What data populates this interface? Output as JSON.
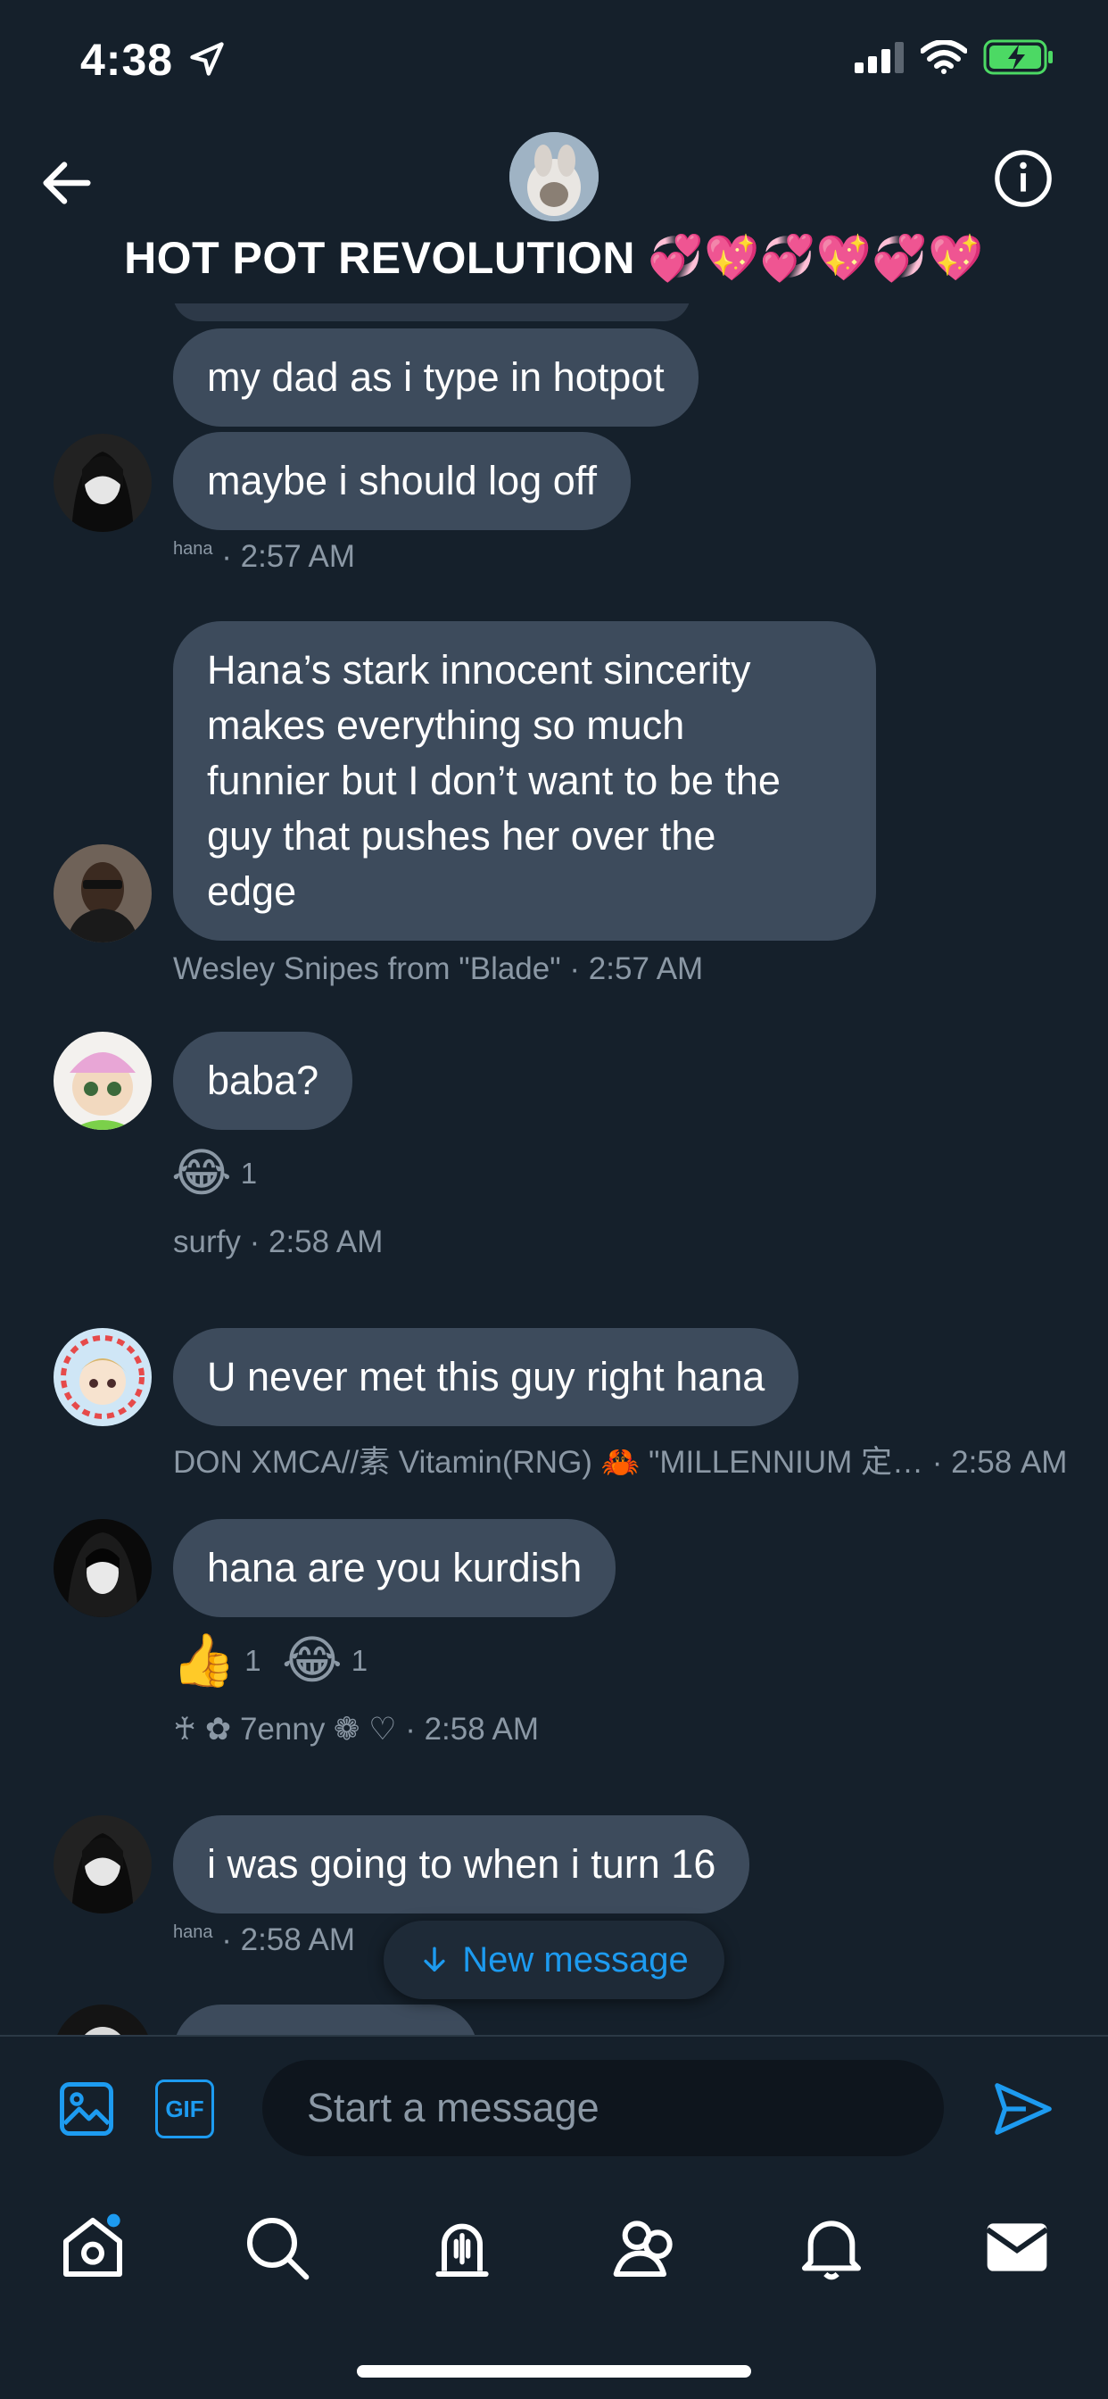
{
  "status_bar": {
    "time": "4:38"
  },
  "header": {
    "title": "HOT POT REVOLUTION 💞💖💞💖💞💖"
  },
  "messages": [
    {
      "text": "my dad as i type in hotpot"
    },
    {
      "text": "maybe i should log off",
      "sender_small": "hana",
      "time": "· 2:57 AM"
    },
    {
      "text": "Hana’s stark innocent sincerity\nmakes everything so much\nfunnier but I don’t want to be the\nguy that pushes her over the\nedge",
      "sender": "Wesley Snipes from \"Blade\"",
      "time": "· 2:57 AM"
    },
    {
      "text": "baba?",
      "reaction_emoji": "😂",
      "reaction_count": "1",
      "sender": "surfy",
      "time": "· 2:58 AM"
    },
    {
      "text": "U never met this guy right hana",
      "sender": "DON XMCA//素 Vitamin(RNG) 🦀 \"MILLENNIUM 定…",
      "time": "· 2:58 AM"
    },
    {
      "text": "hana are you kurdish",
      "reaction1_emoji": "👍",
      "reaction1_count": "1",
      "reaction2_emoji": "😂",
      "reaction2_count": "1",
      "sender": "♰ ✿ 7enny ❁ ♡",
      "time": "· 2:58 AM"
    },
    {
      "text": "i was going to when i turn 16",
      "sender_small": "hana",
      "time": "· 2:58 AM"
    }
  ],
  "new_message_label": "New message",
  "composer": {
    "placeholder": "Start a message",
    "gif_label": "GIF"
  },
  "colors": {
    "background": "#15202b",
    "bubble": "#3d4b5c",
    "accent": "#1d9bf0",
    "meta": "#8b98a5"
  },
  "icons": [
    "arrow-left-icon",
    "info-icon",
    "image-icon",
    "gif-icon",
    "send-icon",
    "home-icon",
    "search-icon",
    "spaces-icon",
    "communities-icon",
    "bell-icon",
    "mail-icon"
  ]
}
